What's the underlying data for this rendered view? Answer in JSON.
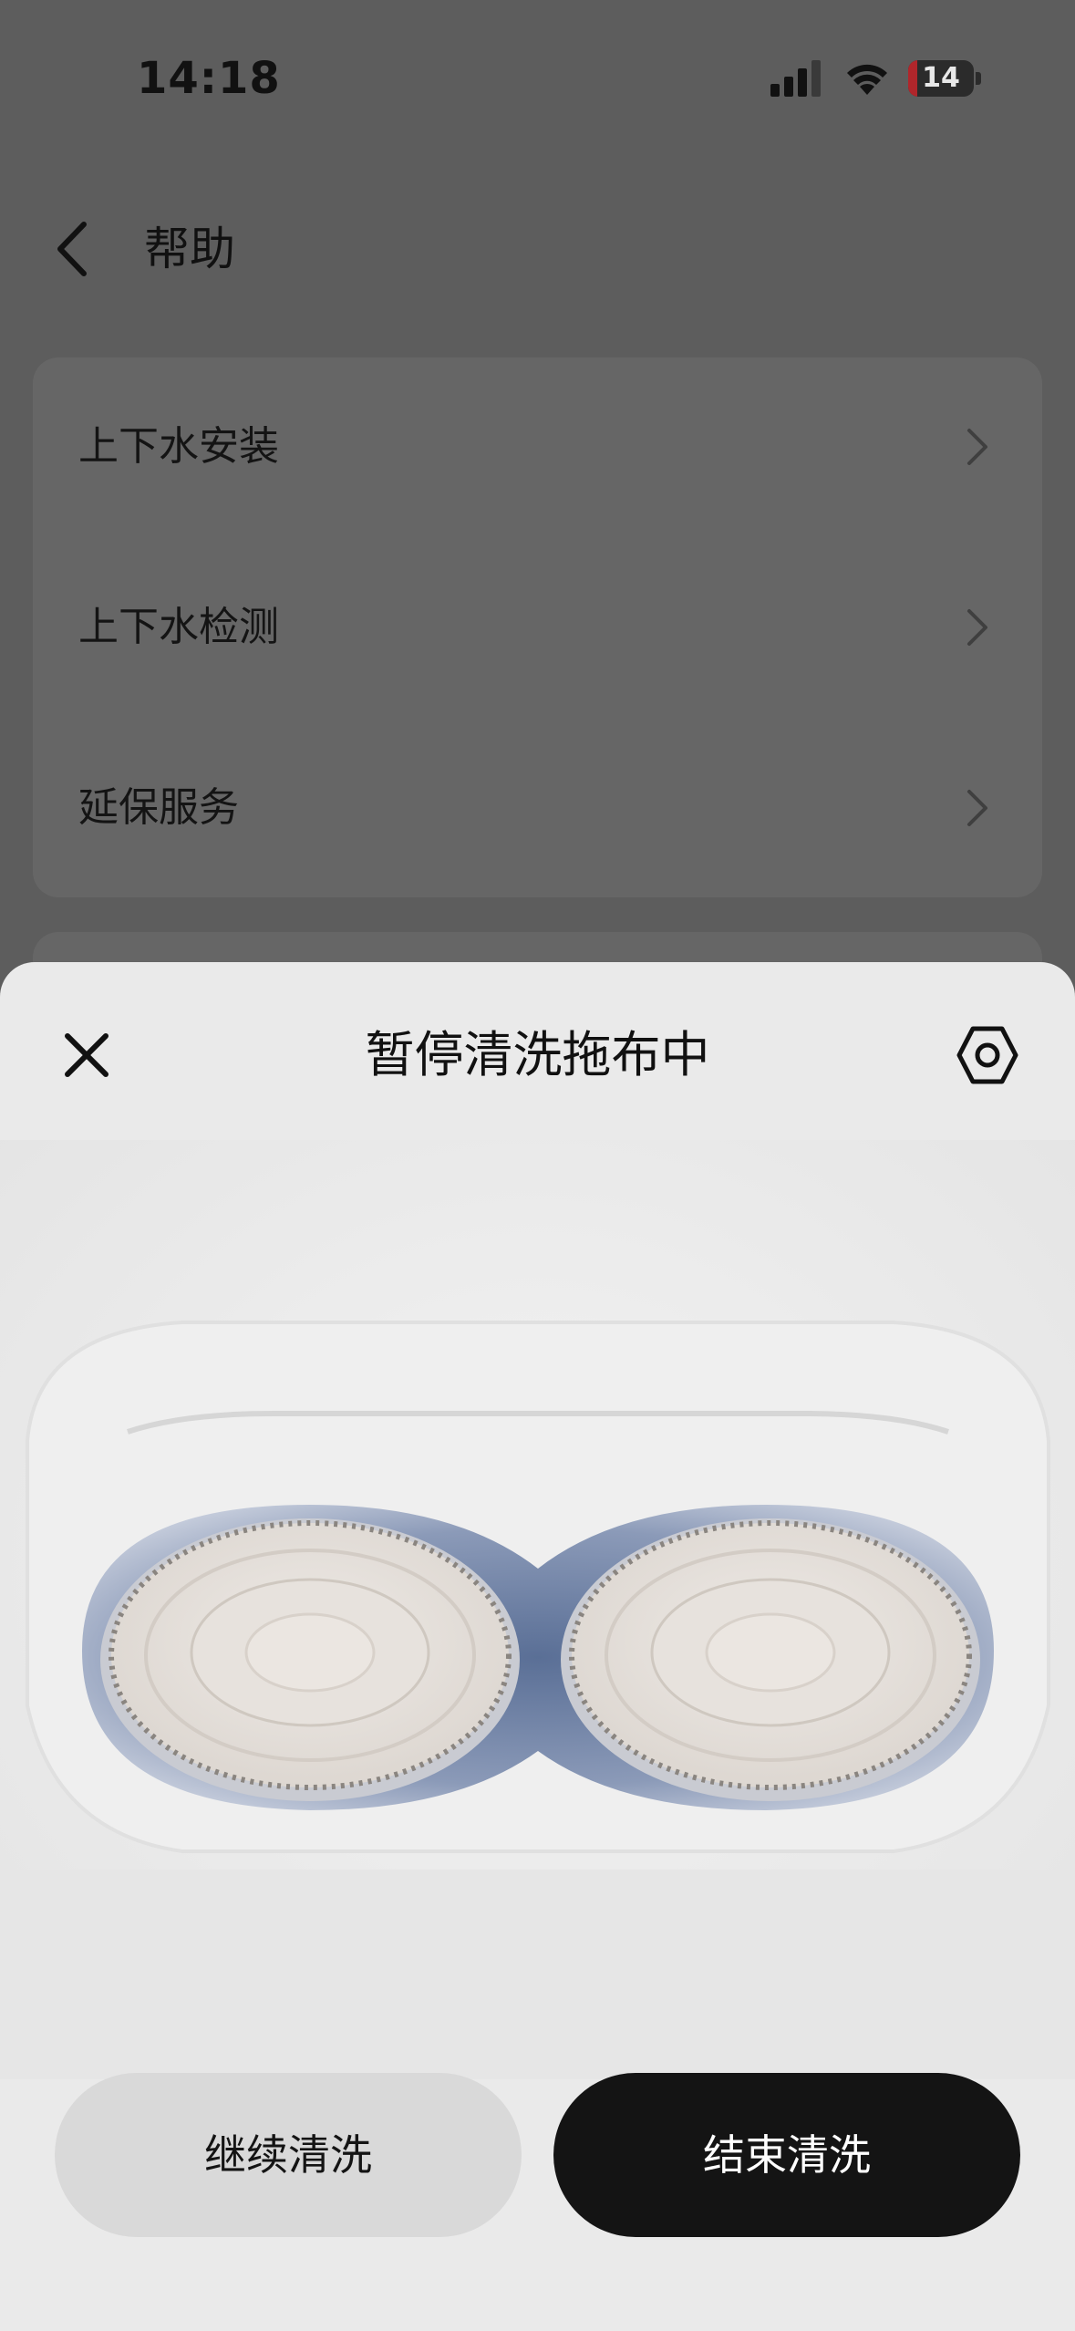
{
  "status_bar": {
    "time": "14:18",
    "battery_level": "14",
    "battery_fraction": 0.14
  },
  "header": {
    "title": "帮助"
  },
  "menu": {
    "items": [
      {
        "label": "上下水安装"
      },
      {
        "label": "上下水检测"
      },
      {
        "label": "延保服务"
      }
    ]
  },
  "sheet": {
    "title": "暂停清洗拖布中",
    "continue_label": "继续清洗",
    "end_label": "结束清洗"
  },
  "colors": {
    "overlay": "#5d5d5d",
    "sheet": "#eaeaea",
    "primary_button": "#141414",
    "battery_low": "#b0262b"
  },
  "icons": [
    "back-icon",
    "chevron-right-icon",
    "close-icon",
    "settings-hex-icon",
    "signal-icon",
    "wifi-icon",
    "battery-icon"
  ]
}
